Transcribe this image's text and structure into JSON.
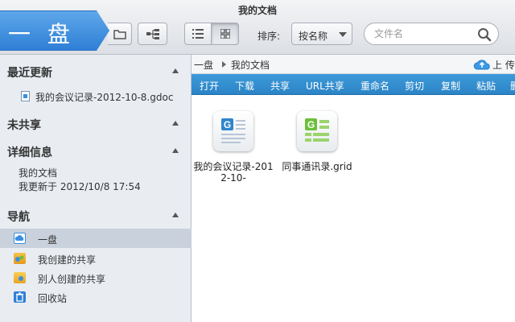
{
  "window": {
    "title": "我的文档"
  },
  "brand": {
    "label": "一 盘"
  },
  "toolbar": {
    "sort_label": "排序:",
    "sort_value": "按名称",
    "search_placeholder": "文件名"
  },
  "sidebar": {
    "recent": {
      "title": "最近更新",
      "items": [
        {
          "label": "我的会议记录-2012-10-8.gdoc"
        }
      ]
    },
    "unshared": {
      "title": "未共享"
    },
    "details": {
      "title": "详细信息",
      "lines": [
        "我的文档",
        "我更新于 2012/10/8 17:54"
      ]
    },
    "nav": {
      "title": "导航",
      "items": [
        {
          "label": "一盘",
          "icon": "cloud-drive-icon"
        },
        {
          "label": "我创建的共享",
          "icon": "shared-folder-icon"
        },
        {
          "label": "别人创建的共享",
          "icon": "folder-icon"
        },
        {
          "label": "回收站",
          "icon": "recycle-bin-icon"
        }
      ]
    }
  },
  "breadcrumb": {
    "root": "一盘",
    "current": "我的文档"
  },
  "upload": {
    "label": "上 传"
  },
  "actions": [
    "打开",
    "下载",
    "共享",
    "URL共享",
    "重命名",
    "剪切",
    "复制",
    "粘贴",
    "删"
  ],
  "files": [
    {
      "name": "我的会议记录-2012-10-",
      "icon": "gdoc-icon"
    },
    {
      "name": "同事通讯录.grid",
      "icon": "grid-icon"
    }
  ],
  "colors": {
    "accent": "#2f86cb",
    "brand": "#3b8ee0",
    "grid_green": "#6dbf3a"
  }
}
